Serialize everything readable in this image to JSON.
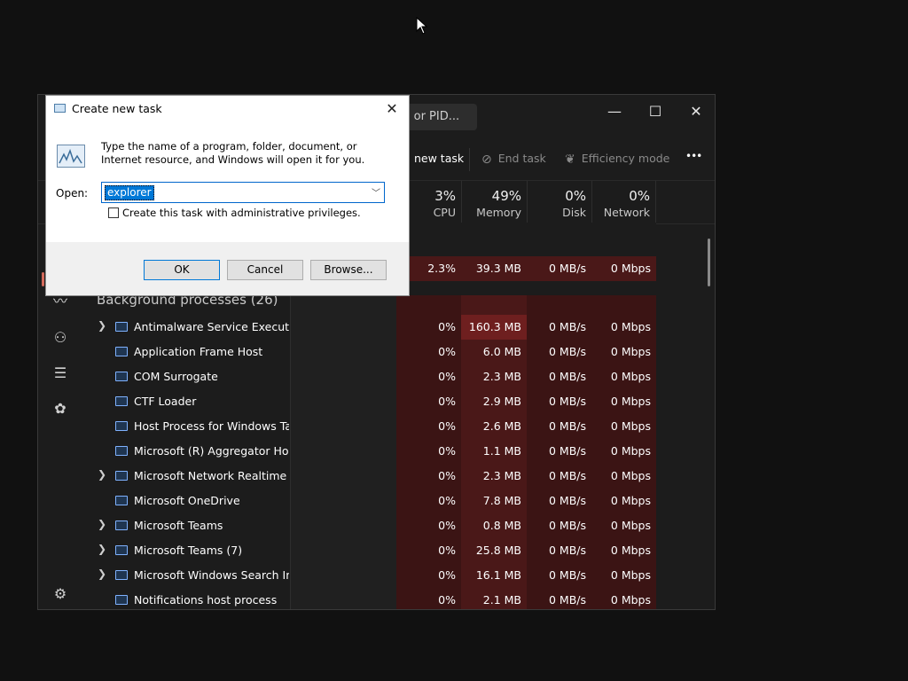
{
  "task_manager": {
    "search_placeholder": "r, or PID...",
    "window_controls": {
      "minimize": "—",
      "maximize": "☐",
      "close": "✕"
    },
    "toolbar": {
      "new_task": "new task",
      "end_task": "End task",
      "efficiency_mode": "Efficiency mode",
      "more": "•••"
    },
    "columns": [
      {
        "pct": "3%",
        "label": "CPU"
      },
      {
        "pct": "49%",
        "label": "Memory"
      },
      {
        "pct": "0%",
        "label": "Disk"
      },
      {
        "pct": "0%",
        "label": "Network"
      }
    ],
    "app_row": {
      "cpu": "2.3%",
      "memory": "39.3 MB",
      "disk": "0 MB/s",
      "network": "0 Mbps"
    },
    "section_title": "Background processes (26)",
    "processes": [
      {
        "name": "Antimalware Service Executable",
        "expand": true,
        "cpu": "0%",
        "memory": "160.3 MB",
        "disk": "0 MB/s",
        "network": "0 Mbps"
      },
      {
        "name": "Application Frame Host",
        "expand": false,
        "cpu": "0%",
        "memory": "6.0 MB",
        "disk": "0 MB/s",
        "network": "0 Mbps"
      },
      {
        "name": "COM Surrogate",
        "expand": false,
        "cpu": "0%",
        "memory": "2.3 MB",
        "disk": "0 MB/s",
        "network": "0 Mbps"
      },
      {
        "name": "CTF Loader",
        "expand": false,
        "cpu": "0%",
        "memory": "2.9 MB",
        "disk": "0 MB/s",
        "network": "0 Mbps"
      },
      {
        "name": "Host Process for Windows Tasks",
        "expand": false,
        "cpu": "0%",
        "memory": "2.6 MB",
        "disk": "0 MB/s",
        "network": "0 Mbps"
      },
      {
        "name": "Microsoft (R) Aggregator Host",
        "expand": false,
        "cpu": "0%",
        "memory": "1.1 MB",
        "disk": "0 MB/s",
        "network": "0 Mbps"
      },
      {
        "name": "Microsoft Network Realtime I...",
        "expand": true,
        "cpu": "0%",
        "memory": "2.3 MB",
        "disk": "0 MB/s",
        "network": "0 Mbps"
      },
      {
        "name": "Microsoft OneDrive",
        "expand": false,
        "cpu": "0%",
        "memory": "7.8 MB",
        "disk": "0 MB/s",
        "network": "0 Mbps"
      },
      {
        "name": "Microsoft Teams",
        "expand": true,
        "cpu": "0%",
        "memory": "0.8 MB",
        "disk": "0 MB/s",
        "network": "0 Mbps"
      },
      {
        "name": "Microsoft Teams (7)",
        "expand": true,
        "cpu": "0%",
        "memory": "25.8 MB",
        "disk": "0 MB/s",
        "network": "0 Mbps"
      },
      {
        "name": "Microsoft Windows Search In...",
        "expand": true,
        "cpu": "0%",
        "memory": "16.1 MB",
        "disk": "0 MB/s",
        "network": "0 Mbps"
      },
      {
        "name": "Notifications host process",
        "expand": false,
        "cpu": "0%",
        "memory": "2.1 MB",
        "disk": "0 MB/s",
        "network": "0 Mbps"
      }
    ],
    "colors": {
      "cpu_bg": "#3b1414",
      "memory_bg": "#4a1818",
      "memory_hot_bg": "#6e1f1f",
      "disk_bg": "#3b1414",
      "network_bg": "#3b1414",
      "accent": "#d36a5b"
    }
  },
  "dialog": {
    "title": "Create new task",
    "close": "✕",
    "description": "Type the name of a program, folder, document, or Internet resource, and Windows will open it for you.",
    "open_label": "Open:",
    "open_value": "explorer",
    "checkbox_label": "Create this task with administrative privileges.",
    "ok": "OK",
    "cancel": "Cancel",
    "browse": "Browse..."
  }
}
